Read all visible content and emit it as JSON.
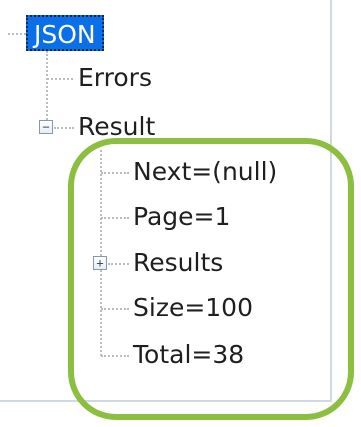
{
  "tree": {
    "root": {
      "label": "JSON",
      "selected": true
    },
    "children": [
      {
        "label": "Errors"
      },
      {
        "label": "Result",
        "expanded": true,
        "expander_icon": "minus-box-icon",
        "children": [
          {
            "label": "Next=(null)"
          },
          {
            "label": "Page=1"
          },
          {
            "label": "Results",
            "expanded": false,
            "expander_icon": "plus-box-icon"
          },
          {
            "label": "Size=100"
          },
          {
            "label": "Total=38"
          }
        ]
      }
    ]
  },
  "colors": {
    "selection": "#0a6fe8",
    "highlight_outline": "#8cbf3f",
    "connector": "#b8bcc4"
  }
}
